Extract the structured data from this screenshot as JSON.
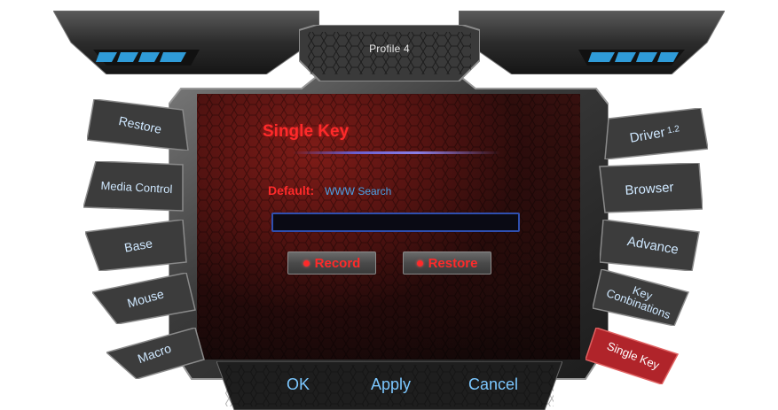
{
  "header": {
    "profile_label": "Profile 4"
  },
  "left_tabs": [
    {
      "label": "Restore"
    },
    {
      "label": "Media Control"
    },
    {
      "label": "Base"
    },
    {
      "label": "Mouse"
    },
    {
      "label": "Macro"
    }
  ],
  "right_tabs": [
    {
      "label": "Driver",
      "sub": "1.2"
    },
    {
      "label": "Browser"
    },
    {
      "label": "Advance"
    },
    {
      "label": "Key Conbinations"
    },
    {
      "label": "Single Key",
      "active": true
    }
  ],
  "main": {
    "title": "Single Key",
    "default_label": "Default:",
    "default_value": "WWW Search",
    "input_value": "",
    "record_label": "Record",
    "restore_label": "Restore"
  },
  "footer": {
    "ok_label": "OK",
    "apply_label": "Apply",
    "cancel_label": "Cancel"
  },
  "colors": {
    "accent_red": "#ff2a2a",
    "tab_text": "#cfe8ff",
    "footer_text": "#7cc7ff",
    "input_border": "#2f4fb0",
    "active_tab": "#b0242a"
  }
}
